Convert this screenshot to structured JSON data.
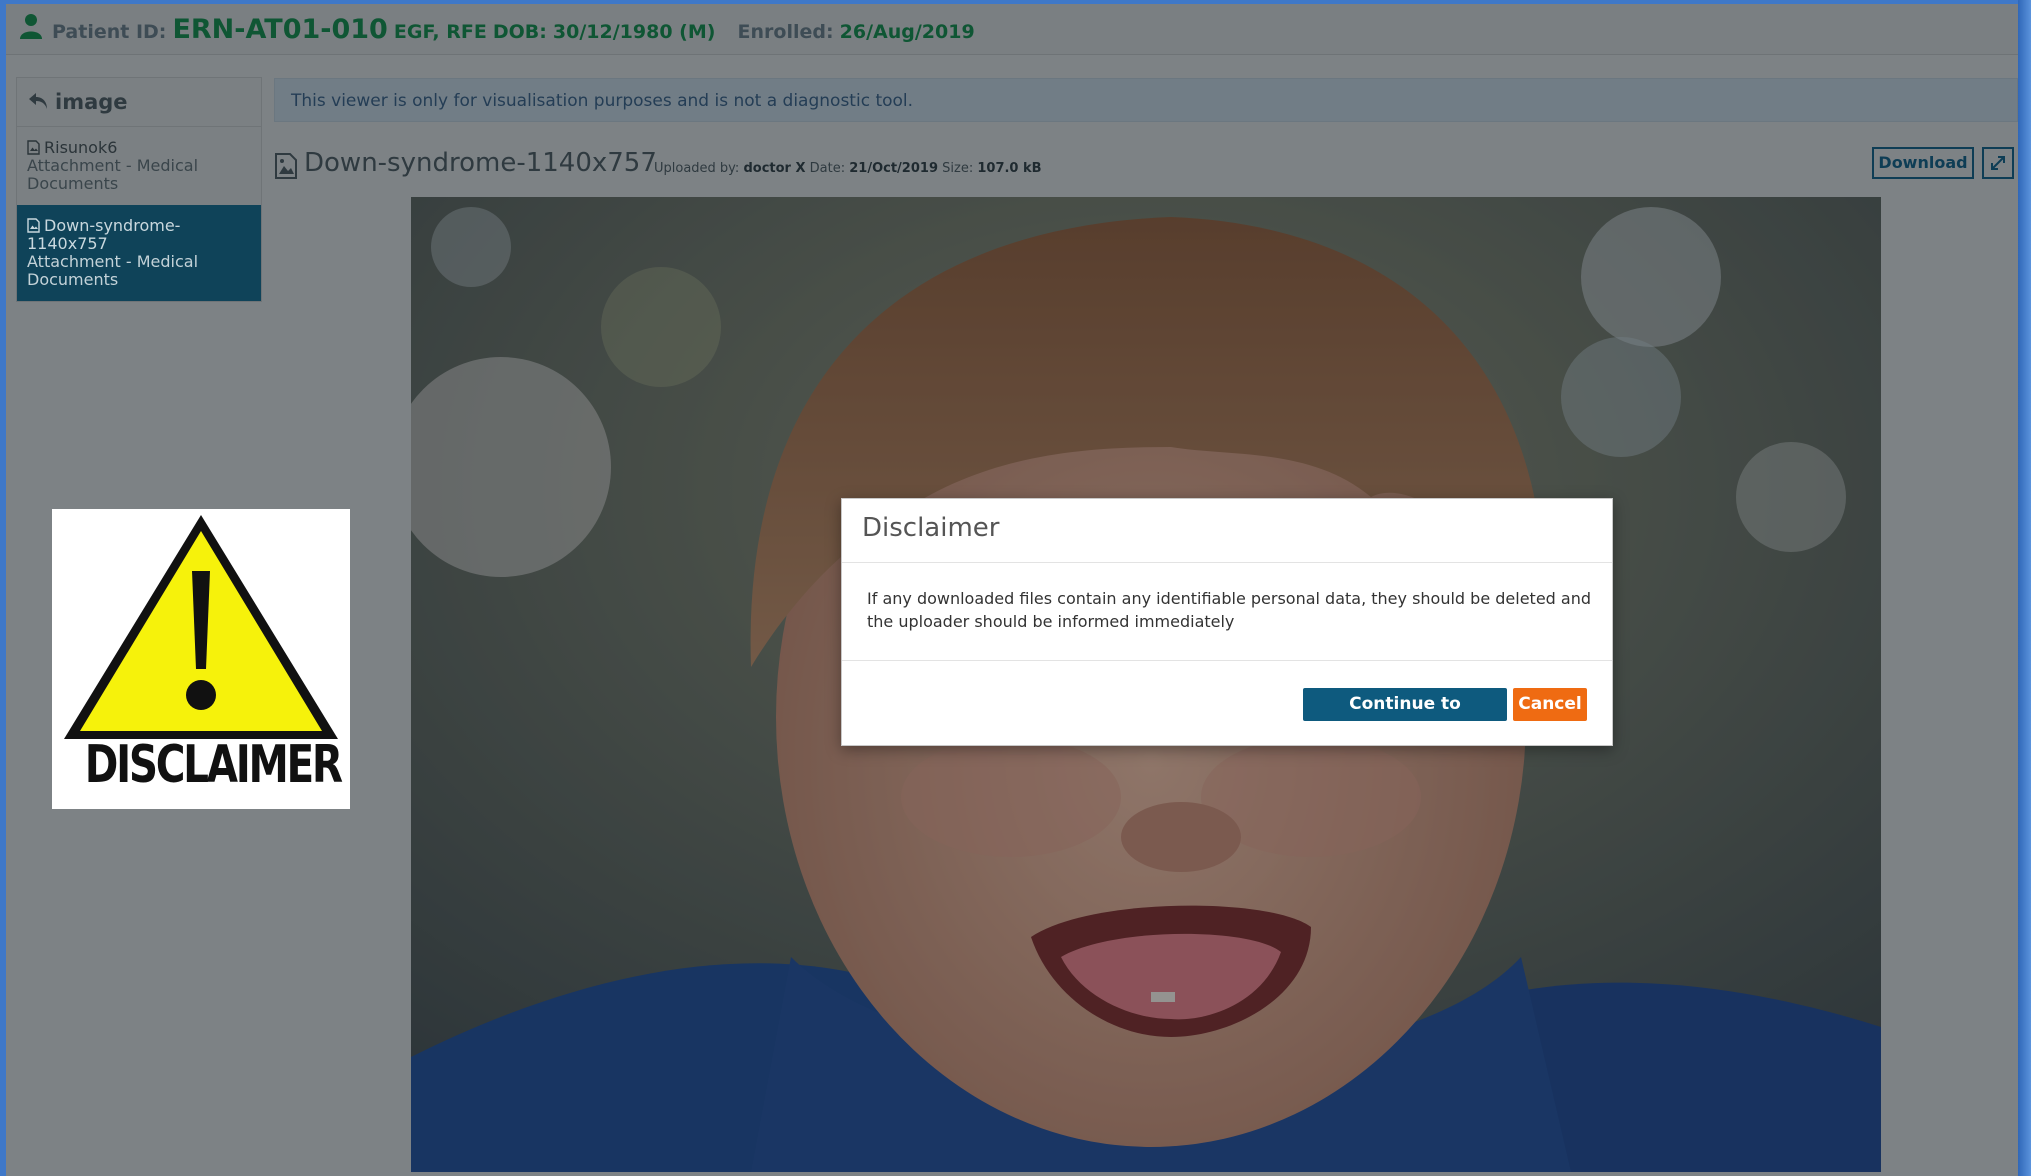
{
  "header": {
    "patient_label": "Patient ID:",
    "patient_id": "ERN-AT01-010",
    "country": "EGF, RFE",
    "dob_label": "DOB:",
    "dob": "30/12/1980 (M)",
    "enrolled_label": "Enrolled:",
    "enrolled": "26/Aug/2019"
  },
  "sidebar": {
    "title": "image",
    "items": [
      {
        "name": "Risunok6",
        "sub": "Attachment - Medical Documents",
        "active": false
      },
      {
        "name": "Down-syndrome-1140x757",
        "sub": "Attachment - Medical Documents",
        "active": true
      }
    ]
  },
  "banner": "This viewer is only for visualisation purposes and is not a diagnostic tool.",
  "file": {
    "title": "Down-syndrome-1140x757",
    "uploaded_label": "Uploaded by:",
    "uploaded_by": "doctor X",
    "date_label": "Date:",
    "date": "21/Oct/2019",
    "size_label": "Size:",
    "size": "107.0 kB",
    "download_label": "Download"
  },
  "disclaimer_graphic": {
    "word": "DISCLAIMER"
  },
  "modal": {
    "title": "Disclaimer",
    "body": "If any downloaded files contain any identifiable personal data, they should be deleted and the uploader should be informed immediately",
    "continue_label": "Continue to download",
    "cancel_label": "Cancel"
  },
  "colors": {
    "accent": "#0e5a7e",
    "cancel": "#ef6b12",
    "active_item": "#0f4359",
    "id_green": "#0f5634"
  },
  "icons": [
    "user-icon",
    "back-arrow-icon",
    "document-icon",
    "image-file-icon",
    "expand-icon",
    "warning-icon"
  ]
}
